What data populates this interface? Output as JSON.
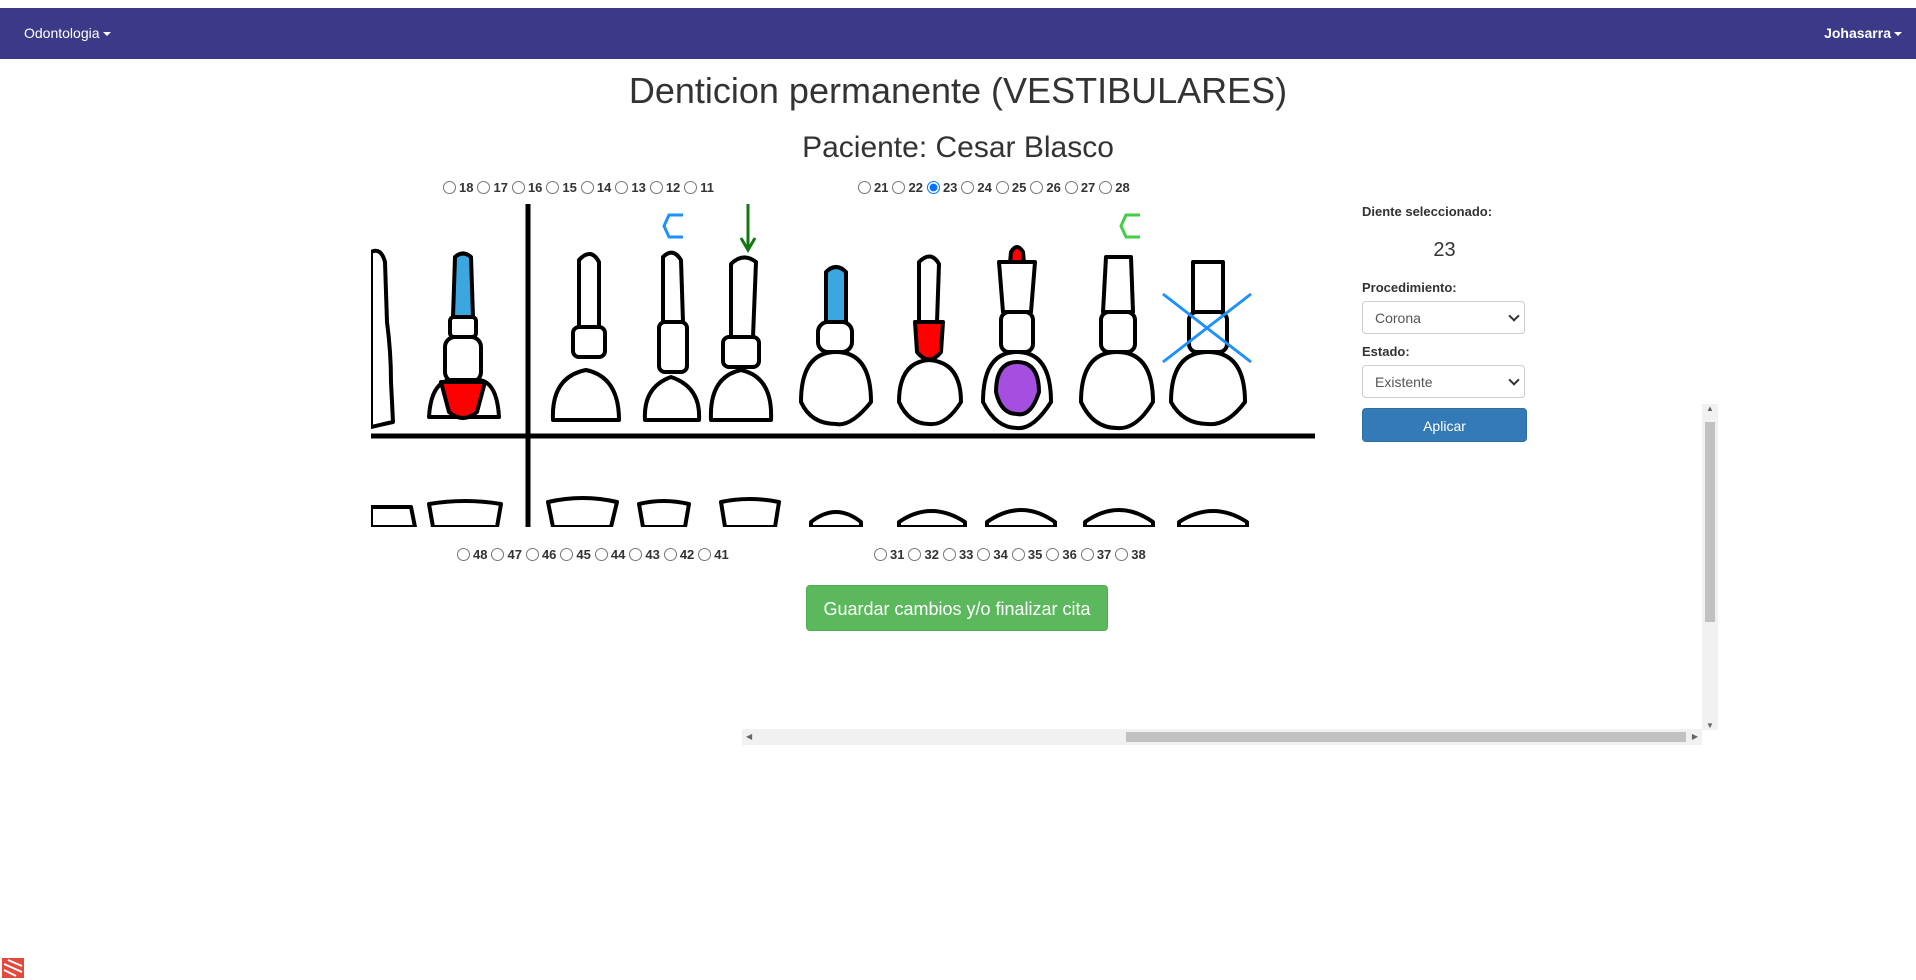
{
  "navbar": {
    "brand": "Odontologia",
    "user": "Johasarra"
  },
  "title": "Denticion permanente (VESTIBULARES)",
  "patient": "Paciente: Cesar Blasco",
  "upper_right_teeth": [
    "18",
    "17",
    "16",
    "15",
    "14",
    "13",
    "12",
    "11"
  ],
  "upper_left_teeth": [
    "21",
    "22",
    "23",
    "24",
    "25",
    "26",
    "27",
    "28"
  ],
  "lower_right_teeth": [
    "48",
    "47",
    "46",
    "45",
    "44",
    "43",
    "42",
    "41"
  ],
  "lower_left_teeth": [
    "31",
    "32",
    "33",
    "34",
    "35",
    "36",
    "37",
    "38"
  ],
  "selected_tooth_radio": "23",
  "panel": {
    "selected_label": "Diente seleccionado:",
    "selected_value": "23",
    "procedure_label": "Procedimiento:",
    "procedure_value": "Corona",
    "status_label": "Estado:",
    "status_value": "Existente",
    "apply_label": "Aplicar"
  },
  "save_button": "Guardar cambios y/o finalizar cita",
  "colors": {
    "navbar": "#3b3a89",
    "apply": "#337ab7",
    "save": "#5cb85c",
    "caries_red": "#ff0000",
    "blue_mark": "#1e90ff",
    "green_mark": "#22aa22",
    "purple_fill": "#a44fe0"
  },
  "odontogram_marks": [
    "blue-crown-mark",
    "green-extrusion-arrow",
    "green-crown-mark",
    "blue-extraction-x",
    "red-caries",
    "blue-filling",
    "purple-filling"
  ]
}
